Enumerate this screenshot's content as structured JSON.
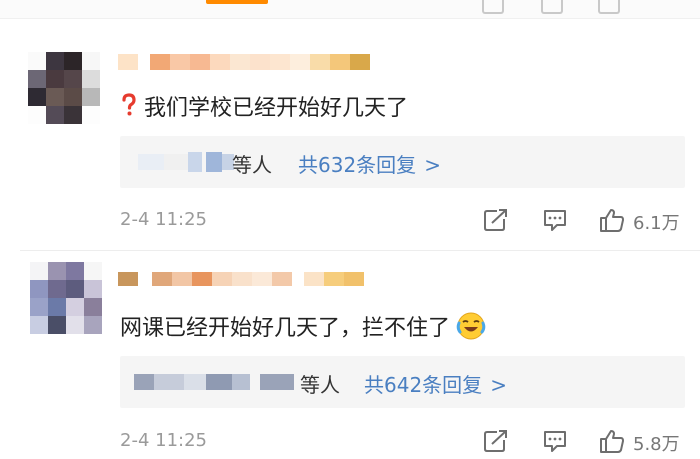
{
  "comments": [
    {
      "text": "我们学校已经开始好几天了",
      "prefix_icon": "question-mark-icon",
      "replies": {
        "suffix": "等人",
        "count_label": "共632条回复",
        "chevron": ">"
      },
      "timestamp": "2-4 11:25",
      "likes": "6.1万"
    },
    {
      "text": "网课已经开始好几天了，拦不住了",
      "suffix_icon": "laughing-crying-emoji-icon",
      "replies": {
        "suffix": "等人",
        "count_label": "共642条回复",
        "chevron": ">"
      },
      "timestamp": "2-4 11:25",
      "likes": "5.8万"
    }
  ],
  "colors": {
    "link_blue": "#4a7fc1",
    "timestamp_gray": "#9a9a9a",
    "reply_bg": "#f5f5f5",
    "question_red": "#e63b2e"
  }
}
